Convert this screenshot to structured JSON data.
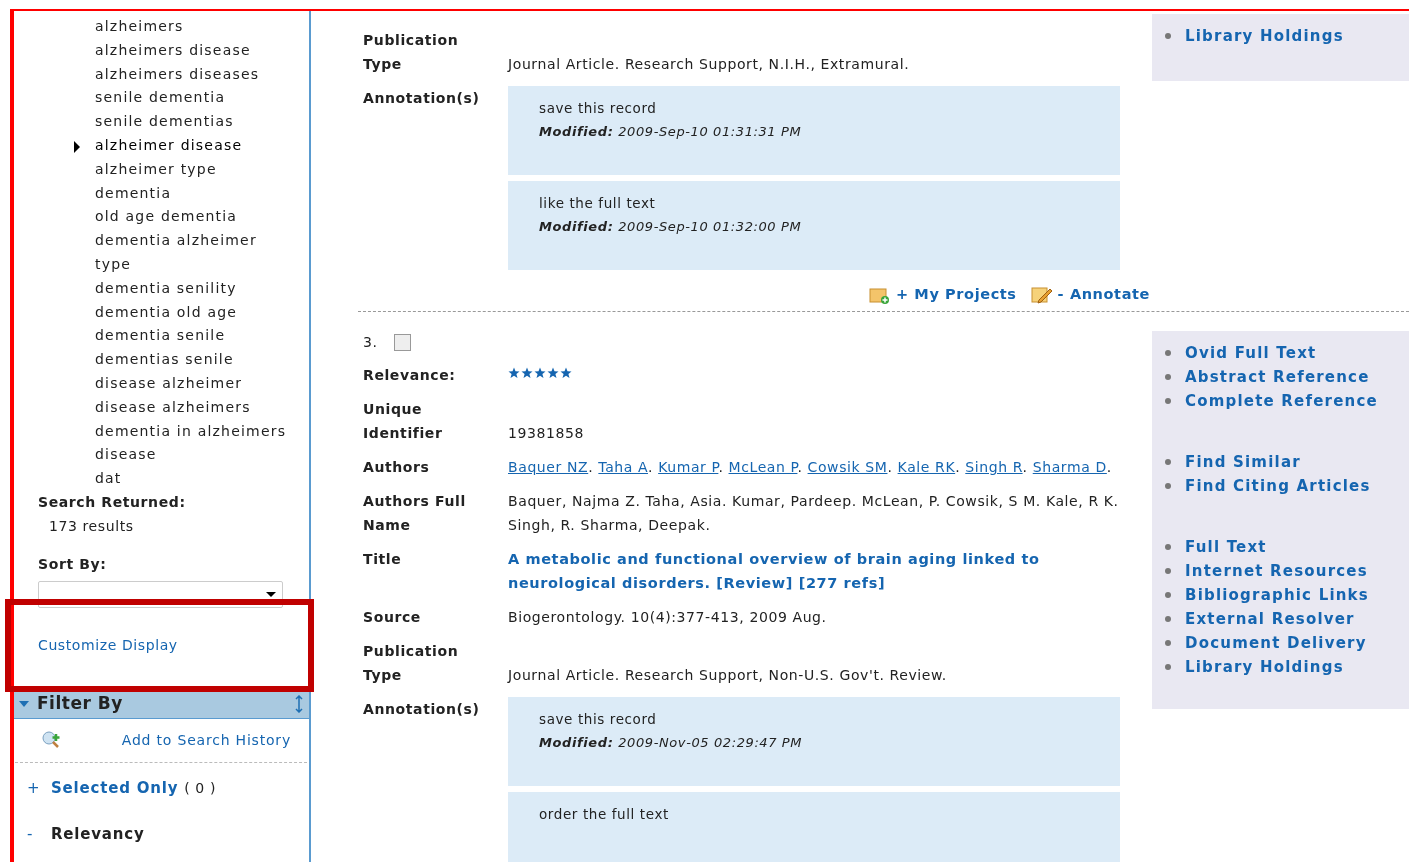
{
  "sidebar": {
    "terms": [
      {
        "label": "alzheimers",
        "selected": false
      },
      {
        "label": "alzheimers disease",
        "selected": false
      },
      {
        "label": "alzheimers diseases",
        "selected": false
      },
      {
        "label": "senile dementia",
        "selected": false
      },
      {
        "label": "senile dementias",
        "selected": false
      },
      {
        "label": "alzheimer disease",
        "selected": true
      },
      {
        "label": "alzheimer type",
        "selected": false
      },
      {
        "label": "dementia",
        "selected": false
      },
      {
        "label": "old age dementia",
        "selected": false
      },
      {
        "label": "dementia alzheimer type",
        "selected": false
      },
      {
        "label": "dementia senility",
        "selected": false
      },
      {
        "label": "dementia old age",
        "selected": false
      },
      {
        "label": "dementia senile",
        "selected": false
      },
      {
        "label": "dementias senile",
        "selected": false
      },
      {
        "label": "disease alzheimer",
        "selected": false
      },
      {
        "label": "disease alzheimers",
        "selected": false
      },
      {
        "label": "dementia in alzheimers disease",
        "selected": false
      },
      {
        "label": "dat",
        "selected": false
      }
    ],
    "search_returned": {
      "label": "Search Returned:",
      "value": "173 results"
    },
    "sort_by": {
      "label": "Sort By:"
    },
    "customize_display": "Customize Display",
    "filter_by": {
      "title": "Filter By",
      "expanded": true,
      "add_history": "Add to Search History",
      "items": [
        {
          "kind": "link",
          "marker": "+",
          "label": "Selected Only",
          "count": "( 0 )"
        },
        {
          "kind": "heading",
          "marker": "-",
          "label": "Relevancy"
        }
      ]
    }
  },
  "records": [
    {
      "fields": [
        {
          "kind": "text",
          "label": "Publication Type",
          "value": "Journal Article. Research Support, N.I.H., Extramural."
        },
        {
          "kind": "annotations",
          "label": "Annotation(s)",
          "items": [
            {
              "text": "save this record",
              "modified": "**Modified:** 2009-Sep-10 01:31:31 PM"
            },
            {
              "text": "like the full text",
              "modified": "**Modified:** 2009-Sep-10 01:32:00 PM"
            }
          ]
        }
      ],
      "actions": [
        "+ My Projects",
        "- Annotate"
      ],
      "link_groups": [
        [
          "Library Holdings"
        ]
      ]
    },
    {
      "number": "3.",
      "checked": false,
      "fields": [
        {
          "kind": "stars",
          "label": "Relevance:",
          "stars": 5
        },
        {
          "kind": "text",
          "label": "Unique Identifier",
          "value": "19381858"
        },
        {
          "kind": "authors",
          "label": "Authors",
          "authors": [
            {
              "name": "Baquer NZ",
              "sep": "."
            },
            {
              "name": "Taha A",
              "sep": "."
            },
            {
              "name": "Kumar P",
              "sep": "."
            },
            {
              "name": "McLean P",
              "sep": "."
            },
            {
              "name": "Cowsik SM",
              "sep": "."
            },
            {
              "name": "Kale RK",
              "sep": "."
            },
            {
              "name": "Singh R",
              "sep": "."
            },
            {
              "name": "Sharma D",
              "sep": "."
            }
          ]
        },
        {
          "kind": "text",
          "label": "Authors Full Name",
          "value": "Baquer, Najma Z. Taha, Asia. Kumar, Pardeep. McLean, P. Cowsik, S M. Kale, R K. Singh, R. Sharma, Deepak."
        },
        {
          "kind": "title",
          "label": "Title",
          "value": "A metabolic and functional overview of brain aging linked to neurological disorders. [Review] [277 refs]"
        },
        {
          "kind": "text",
          "label": "Source",
          "value": "Biogerontology. 10(4):377-413, 2009 Aug."
        },
        {
          "kind": "text",
          "label": "Publication Type",
          "value": "Journal Article. Research Support, Non-U.S. Gov't. Review."
        },
        {
          "kind": "annotations",
          "label": "Annotation(s)",
          "items": [
            {
              "text": "save this record",
              "modified": "**Modified:** 2009-Nov-05 02:29:47 PM"
            },
            {
              "text": "order the full text"
            }
          ]
        }
      ],
      "link_groups": [
        [
          "Ovid Full Text",
          "Abstract Reference",
          "Complete Reference"
        ],
        [
          "Find Similar",
          "Find Citing Articles"
        ],
        [
          "Full Text",
          "Internet Resources",
          "Bibliographic Links",
          "External Resolver",
          "Document Delivery",
          "Library Holdings"
        ]
      ]
    }
  ]
}
